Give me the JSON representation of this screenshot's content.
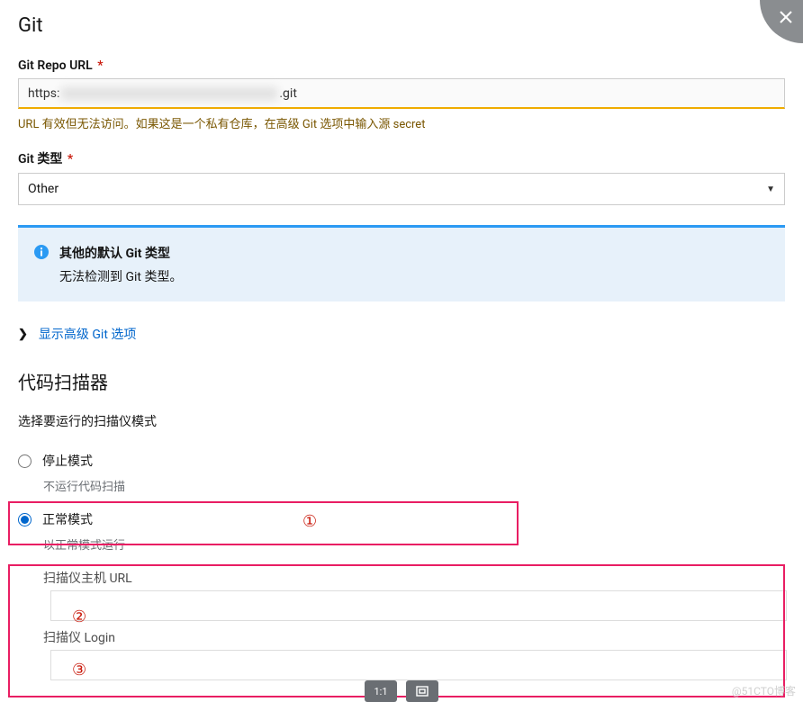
{
  "header": {
    "title": "Git"
  },
  "gitRepo": {
    "label": "Git Repo URL",
    "url_prefix": "https:",
    "url_suffix": ".git",
    "warning": "URL 有效但无法访问。如果这是一个私有仓库，在高级 Git 选项中输入源 secret"
  },
  "gitType": {
    "label": "Git 类型",
    "value": "Other"
  },
  "infoPanel": {
    "title": "其他的默认 Git 类型",
    "body": "无法检测到 Git 类型。"
  },
  "advanced": {
    "link": "显示高级 Git 选项"
  },
  "scanner": {
    "title": "代码扫描器",
    "desc": "选择要运行的扫描仪模式",
    "modes": {
      "stop": {
        "label": "停止模式",
        "hint": "不运行代码扫描"
      },
      "normal": {
        "label": "正常模式",
        "hint": "以正常模式运行"
      }
    },
    "fields": {
      "host": {
        "label": "扫描仪主机 URL"
      },
      "login": {
        "label": "扫描仪 Login"
      }
    }
  },
  "annotations": {
    "a1": "①",
    "a2": "②",
    "a3": "③"
  },
  "toolbar": {
    "ratio": "1:1"
  },
  "watermark": "@51CTO博客"
}
